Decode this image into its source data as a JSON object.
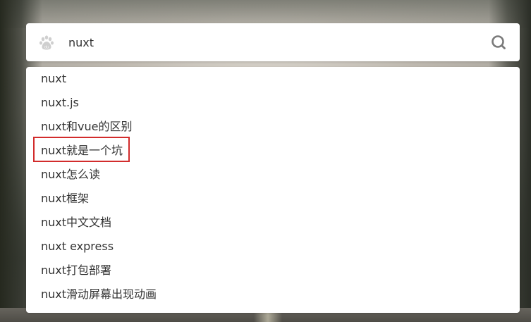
{
  "search": {
    "value": "nuxt",
    "placeholder": ""
  },
  "icons": {
    "logo": "baidu-paw-icon",
    "search": "search-icon"
  },
  "suggestions": [
    "nuxt",
    "nuxt.js",
    "nuxt和vue的区别",
    "nuxt就是一个坑",
    "nuxt怎么读",
    "nuxt框架",
    "nuxt中文文档",
    "nuxt express",
    "nuxt打包部署",
    "nuxt滑动屏幕出现动画"
  ],
  "colors": {
    "highlight_border": "#d22c2c",
    "text": "#333333",
    "icon": "#7a7a7a"
  }
}
